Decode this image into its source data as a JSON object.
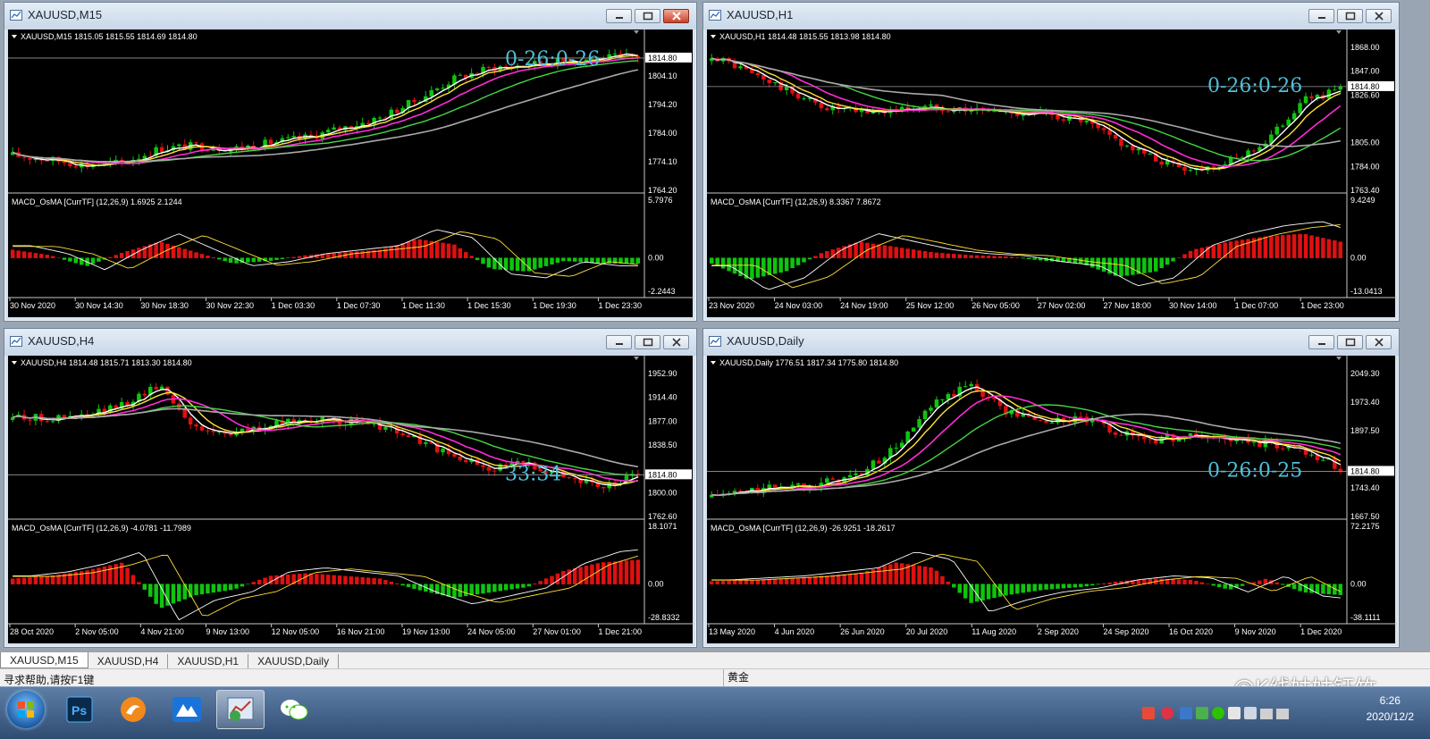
{
  "windows": [
    {
      "id": "m15",
      "title": "XAUUSD,M15",
      "info": "XAUUSD,M15  1815.05 1815.55 1814.69 1814.80",
      "price_scale": [
        "1814.80",
        "1804.10",
        "1794.20",
        "1784.00",
        "1774.10",
        "1764.20"
      ],
      "current_price": "1814.80",
      "countdown": "0-26:0-26",
      "macd_label": "MACD_OsMA [CurrTF] (12,26,9) 1.6925 2.1244",
      "macd_scale": [
        "5.7976",
        "0.00",
        "-2.2443"
      ],
      "time_labels": [
        "30 Nov 2020",
        "30 Nov 14:30",
        "30 Nov 18:30",
        "30 Nov 22:30",
        "1 Dec 03:30",
        "1 Dec 07:30",
        "1 Dec 11:30",
        "1 Dec 15:30",
        "1 Dec 19:30",
        "1 Dec 23:30"
      ],
      "buttons": {
        "minimize": "minimize",
        "restore": "restore",
        "close": "close"
      }
    },
    {
      "id": "h1",
      "title": "XAUUSD,H1",
      "info": "XAUUSD,H1  1814.48 1815.55 1813.98 1814.80",
      "price_scale": [
        "1868.00",
        "1847.00",
        "1826.60",
        "1814.80",
        "1805.00",
        "1784.00",
        "1763.40"
      ],
      "current_price": "1814.80",
      "countdown": "0-26:0-26",
      "macd_label": "MACD_OsMA [CurrTF] (12,26,9) 8.3367 7.8672",
      "macd_scale": [
        "9.4249",
        "0.00",
        "-13.0413"
      ],
      "time_labels": [
        "23 Nov 2020",
        "24 Nov 03:00",
        "24 Nov 19:00",
        "25 Nov 12:00",
        "26 Nov 05:00",
        "27 Nov 02:00",
        "27 Nov 18:00",
        "30 Nov 14:00",
        "1 Dec 07:00",
        "1 Dec 23:00"
      ]
    },
    {
      "id": "h4",
      "title": "XAUUSD,H4",
      "info": "XAUUSD,H4  1814.48 1815.71 1813.30 1814.80",
      "price_scale": [
        "1952.90",
        "1914.40",
        "1877.00",
        "1838.50",
        "1814.80",
        "1800.00",
        "1762.60"
      ],
      "current_price": "1814.80",
      "countdown": "33:34",
      "macd_label": "MACD_OsMA [CurrTF] (12,26,9) -4.0781 -11.7989",
      "macd_scale": [
        "18.1071",
        "0.00",
        "-28.8332"
      ],
      "time_labels": [
        "28 Oct 2020",
        "2 Nov 05:00",
        "4 Nov 21:00",
        "9 Nov 13:00",
        "12 Nov 05:00",
        "16 Nov 21:00",
        "19 Nov 13:00",
        "24 Nov 05:00",
        "27 Nov 01:00",
        "1 Dec 21:00"
      ]
    },
    {
      "id": "d1",
      "title": "XAUUSD,Daily",
      "info": "XAUUSD,Daily  1776.51 1817.34 1775.80 1814.80",
      "price_scale": [
        "2049.30",
        "1973.40",
        "1897.50",
        "1814.80",
        "1743.40",
        "1667.50"
      ],
      "current_price": "1814.80",
      "countdown": "0-26:0-25",
      "macd_label": "MACD_OsMA [CurrTF] (12,26,9) -26.9251 -18.2617",
      "macd_scale": [
        "72.2175",
        "0.00",
        "-38.1111"
      ],
      "time_labels": [
        "13 May 2020",
        "4 Jun 2020",
        "26 Jun 2020",
        "20 Jul 2020",
        "11 Aug 2020",
        "2 Sep 2020",
        "24 Sep 2020",
        "16 Oct 2020",
        "9 Nov 2020",
        "1 Dec 2020"
      ]
    }
  ],
  "tabs": [
    "XAUUSD,M15",
    "XAUUSD,H4",
    "XAUUSD,H1",
    "XAUUSD,Daily"
  ],
  "status": {
    "help": "寻求帮助,请按F1键",
    "symbol_name": "黄金"
  },
  "watermark": "@K线姑姑钰竹",
  "clock": {
    "time": "6:26",
    "date": "2020/12/2"
  },
  "colors": {
    "bull": "#0fc40f",
    "bear": "#e01010",
    "ma_white": "#ffffff",
    "ma_yellow": "#ffe135",
    "ma_magenta": "#ff2bd6",
    "ma_green": "#45d645",
    "ma_gray": "#a9a9a9",
    "countdown": "#4ec0d8"
  }
}
